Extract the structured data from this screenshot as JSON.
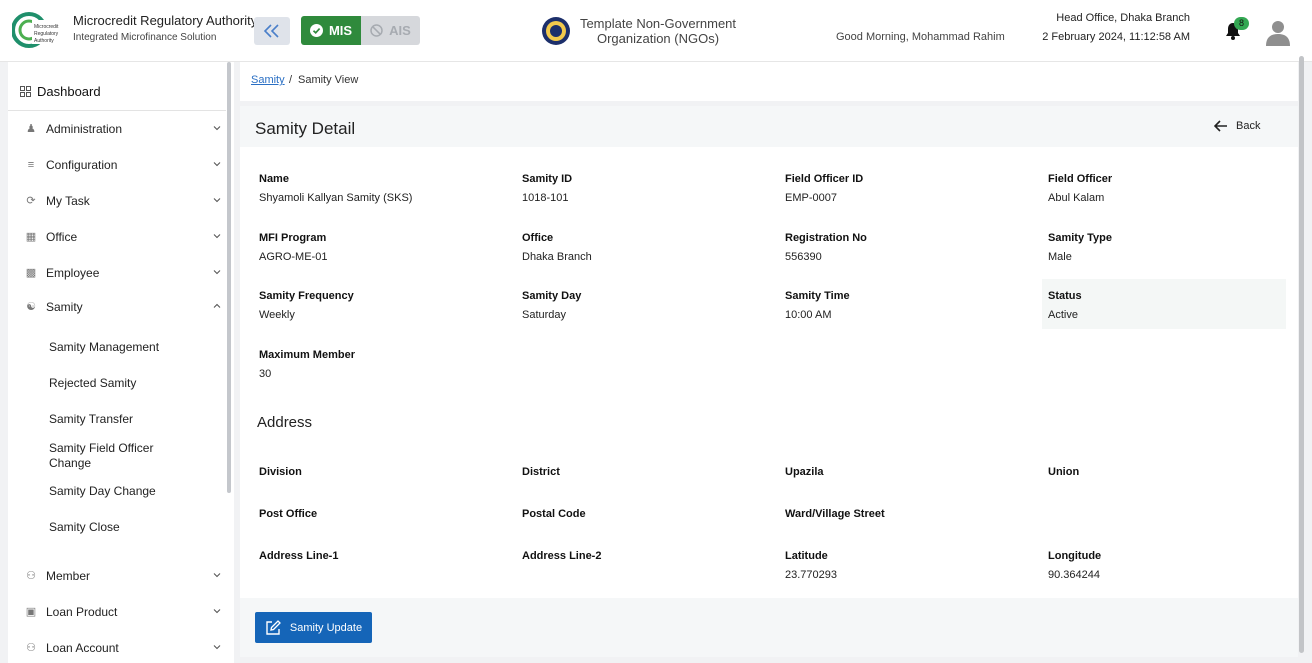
{
  "header": {
    "logo_text": "Microcredit Regulatory Authority",
    "org_title": "Microcredit Regulatory Authority",
    "org_subtitle": "Integrated Microfinance Solution",
    "mis_label": "MIS",
    "ais_label": "AIS",
    "org_name": "Template Non-Government Organization (NGOs)",
    "greeting": "Good Morning, Mohammad Rahim",
    "branch": "Head Office, Dhaka Branch",
    "datetime": "2 February 2024, 11:12:58 AM",
    "notification_count": "8"
  },
  "sidebar": {
    "dashboard": "Dashboard",
    "items": [
      {
        "label": "Administration",
        "icon": "users-icon"
      },
      {
        "label": "Configuration",
        "icon": "sliders-icon"
      },
      {
        "label": "My Task",
        "icon": "refresh-icon"
      },
      {
        "label": "Office",
        "icon": "building-icon"
      },
      {
        "label": "Employee",
        "icon": "id-card-icon"
      },
      {
        "label": "Samity",
        "icon": "group-icon"
      },
      {
        "label": "Member",
        "icon": "members-icon"
      },
      {
        "label": "Loan Product",
        "icon": "box-icon"
      },
      {
        "label": "Loan Account",
        "icon": "account-icon"
      }
    ],
    "samity_sub": [
      "Samity Management",
      "Rejected Samity",
      "Samity Transfer",
      "Samity Field Officer Change",
      "Samity Day Change",
      "Samity Close"
    ]
  },
  "breadcrumb": {
    "link": "Samity",
    "separator": "/",
    "current": "Samity View"
  },
  "detail": {
    "title": "Samity Detail",
    "back_label": "Back",
    "fields": [
      {
        "label": "Name",
        "value": "Shyamoli Kallyan Samity (SKS)"
      },
      {
        "label": "Samity ID",
        "value": "1018-101"
      },
      {
        "label": "Field Officer ID",
        "value": "EMP-0007"
      },
      {
        "label": "Field Officer",
        "value": "Abul Kalam"
      },
      {
        "label": "MFI Program",
        "value": "AGRO-ME-01"
      },
      {
        "label": "Office",
        "value": "Dhaka Branch"
      },
      {
        "label": "Registration No",
        "value": "556390"
      },
      {
        "label": "Samity Type",
        "value": "Male"
      },
      {
        "label": "Samity Frequency",
        "value": "Weekly"
      },
      {
        "label": "Samity Day",
        "value": "Saturday"
      },
      {
        "label": "Samity Time",
        "value": "10:00 AM"
      },
      {
        "label": "Status",
        "value": "Active"
      },
      {
        "label": "Maximum Member",
        "value": "30"
      }
    ],
    "address_title": "Address",
    "address": [
      {
        "label": "Division",
        "value": ""
      },
      {
        "label": "District",
        "value": ""
      },
      {
        "label": "Upazila",
        "value": ""
      },
      {
        "label": "Union",
        "value": ""
      },
      {
        "label": "Post Office",
        "value": ""
      },
      {
        "label": "Postal Code",
        "value": ""
      },
      {
        "label": "Ward/Village Street",
        "value": ""
      },
      {
        "label": "Address Line-1",
        "value": ""
      },
      {
        "label": "Address Line-2",
        "value": ""
      },
      {
        "label": "Latitude",
        "value": "23.770293"
      },
      {
        "label": "Longitude",
        "value": "90.364244"
      }
    ],
    "update_label": "Samity Update"
  },
  "colors": {
    "primary": "#1565b8",
    "mis": "#2f8a3c",
    "badge": "#34a853"
  }
}
